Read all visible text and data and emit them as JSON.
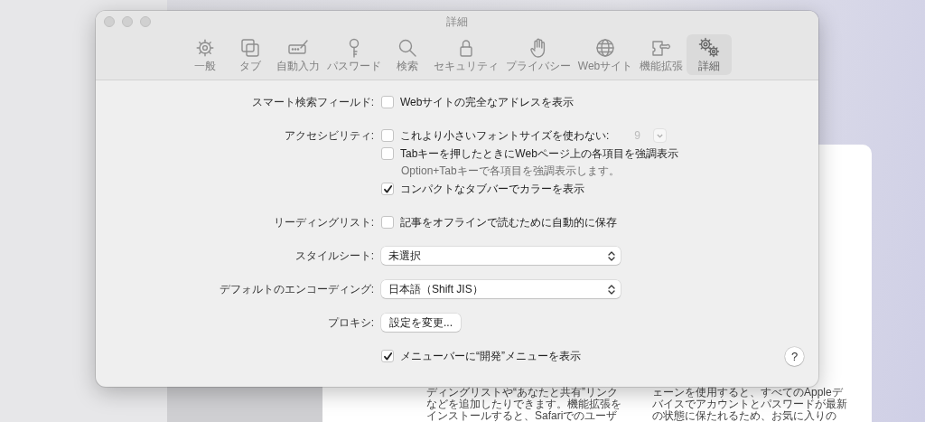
{
  "window": {
    "title": "詳細"
  },
  "toolbar": {
    "tabs": [
      {
        "label": "一般",
        "selected": false
      },
      {
        "label": "タブ",
        "selected": false
      },
      {
        "label": "自動入力",
        "selected": false
      },
      {
        "label": "パスワード",
        "selected": false
      },
      {
        "label": "検索",
        "selected": false
      },
      {
        "label": "セキュリティ",
        "selected": false
      },
      {
        "label": "プライバシー",
        "selected": false
      },
      {
        "label": "Webサイト",
        "selected": false
      },
      {
        "label": "機能拡張",
        "selected": false
      },
      {
        "label": "詳細",
        "selected": true
      }
    ]
  },
  "settings": [
    {
      "label": "スマート検索フィールド:",
      "controls": [
        {
          "kind": "checkbox",
          "text": "Webサイトの完全なアドレスを表示",
          "checked": false
        }
      ]
    },
    {
      "label": "アクセシビリティ:",
      "controls": [
        {
          "kind": "checkbox",
          "text": "これより小さいフォントサイズを使わない:",
          "checked": false,
          "font_size": "9"
        },
        {
          "kind": "checkbox",
          "text": "Tabキーを押したときにWebページ上の各項目を強調表示",
          "checked": false
        },
        {
          "kind": "hint",
          "text": "Option+Tabキーで各項目を強調表示します。"
        },
        {
          "kind": "checkbox",
          "text": "コンパクトなタブバーでカラーを表示",
          "checked": true
        }
      ]
    },
    {
      "label": "リーディングリスト:",
      "controls": [
        {
          "kind": "checkbox",
          "text": "記事をオフラインで読むために自動的に保存",
          "checked": false
        }
      ]
    },
    {
      "label": "スタイルシート:",
      "controls": [
        {
          "kind": "select",
          "value": "未選択"
        }
      ]
    },
    {
      "label": "デフォルトのエンコーディング:",
      "controls": [
        {
          "kind": "select",
          "value": "日本語（Shift JIS）"
        }
      ]
    },
    {
      "label": "プロキシ:",
      "controls": [
        {
          "kind": "button",
          "text": "設定を変更..."
        }
      ]
    },
    {
      "controls": [
        {
          "kind": "checkbox",
          "text": "メニューバーに“開発”メニューを表示",
          "checked": true
        }
      ]
    }
  ],
  "help_button": "?",
  "background_document": {
    "columns": [
      [
        "ディングリストや“あなたと共有”リンク",
        "などを追加したりできます。機能拡張を",
        "インストールすると、Safariでのユーザ"
      ],
      [
        "ェーンを使用すると、すべてのAppleデ",
        "バイスでアカウントとパスワードが最新",
        "の状態に保たれるため、お気に入りの"
      ]
    ]
  }
}
